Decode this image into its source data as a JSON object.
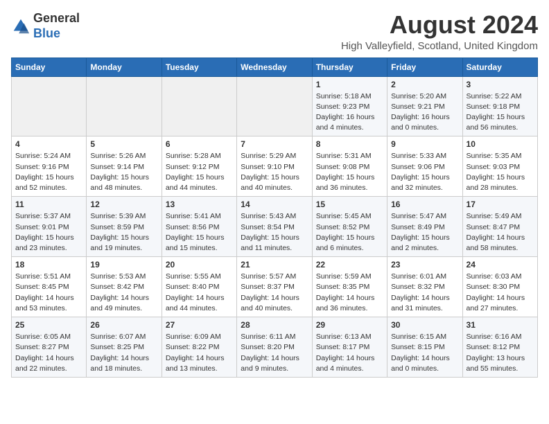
{
  "logo": {
    "general": "General",
    "blue": "Blue"
  },
  "header": {
    "month_title": "August 2024",
    "location": "High Valleyfield, Scotland, United Kingdom"
  },
  "weekdays": [
    "Sunday",
    "Monday",
    "Tuesday",
    "Wednesday",
    "Thursday",
    "Friday",
    "Saturday"
  ],
  "weeks": [
    [
      {
        "day": "",
        "info": ""
      },
      {
        "day": "",
        "info": ""
      },
      {
        "day": "",
        "info": ""
      },
      {
        "day": "",
        "info": ""
      },
      {
        "day": "1",
        "info": "Sunrise: 5:18 AM\nSunset: 9:23 PM\nDaylight: 16 hours\nand 4 minutes."
      },
      {
        "day": "2",
        "info": "Sunrise: 5:20 AM\nSunset: 9:21 PM\nDaylight: 16 hours\nand 0 minutes."
      },
      {
        "day": "3",
        "info": "Sunrise: 5:22 AM\nSunset: 9:18 PM\nDaylight: 15 hours\nand 56 minutes."
      }
    ],
    [
      {
        "day": "4",
        "info": "Sunrise: 5:24 AM\nSunset: 9:16 PM\nDaylight: 15 hours\nand 52 minutes."
      },
      {
        "day": "5",
        "info": "Sunrise: 5:26 AM\nSunset: 9:14 PM\nDaylight: 15 hours\nand 48 minutes."
      },
      {
        "day": "6",
        "info": "Sunrise: 5:28 AM\nSunset: 9:12 PM\nDaylight: 15 hours\nand 44 minutes."
      },
      {
        "day": "7",
        "info": "Sunrise: 5:29 AM\nSunset: 9:10 PM\nDaylight: 15 hours\nand 40 minutes."
      },
      {
        "day": "8",
        "info": "Sunrise: 5:31 AM\nSunset: 9:08 PM\nDaylight: 15 hours\nand 36 minutes."
      },
      {
        "day": "9",
        "info": "Sunrise: 5:33 AM\nSunset: 9:06 PM\nDaylight: 15 hours\nand 32 minutes."
      },
      {
        "day": "10",
        "info": "Sunrise: 5:35 AM\nSunset: 9:03 PM\nDaylight: 15 hours\nand 28 minutes."
      }
    ],
    [
      {
        "day": "11",
        "info": "Sunrise: 5:37 AM\nSunset: 9:01 PM\nDaylight: 15 hours\nand 23 minutes."
      },
      {
        "day": "12",
        "info": "Sunrise: 5:39 AM\nSunset: 8:59 PM\nDaylight: 15 hours\nand 19 minutes."
      },
      {
        "day": "13",
        "info": "Sunrise: 5:41 AM\nSunset: 8:56 PM\nDaylight: 15 hours\nand 15 minutes."
      },
      {
        "day": "14",
        "info": "Sunrise: 5:43 AM\nSunset: 8:54 PM\nDaylight: 15 hours\nand 11 minutes."
      },
      {
        "day": "15",
        "info": "Sunrise: 5:45 AM\nSunset: 8:52 PM\nDaylight: 15 hours\nand 6 minutes."
      },
      {
        "day": "16",
        "info": "Sunrise: 5:47 AM\nSunset: 8:49 PM\nDaylight: 15 hours\nand 2 minutes."
      },
      {
        "day": "17",
        "info": "Sunrise: 5:49 AM\nSunset: 8:47 PM\nDaylight: 14 hours\nand 58 minutes."
      }
    ],
    [
      {
        "day": "18",
        "info": "Sunrise: 5:51 AM\nSunset: 8:45 PM\nDaylight: 14 hours\nand 53 minutes."
      },
      {
        "day": "19",
        "info": "Sunrise: 5:53 AM\nSunset: 8:42 PM\nDaylight: 14 hours\nand 49 minutes."
      },
      {
        "day": "20",
        "info": "Sunrise: 5:55 AM\nSunset: 8:40 PM\nDaylight: 14 hours\nand 44 minutes."
      },
      {
        "day": "21",
        "info": "Sunrise: 5:57 AM\nSunset: 8:37 PM\nDaylight: 14 hours\nand 40 minutes."
      },
      {
        "day": "22",
        "info": "Sunrise: 5:59 AM\nSunset: 8:35 PM\nDaylight: 14 hours\nand 36 minutes."
      },
      {
        "day": "23",
        "info": "Sunrise: 6:01 AM\nSunset: 8:32 PM\nDaylight: 14 hours\nand 31 minutes."
      },
      {
        "day": "24",
        "info": "Sunrise: 6:03 AM\nSunset: 8:30 PM\nDaylight: 14 hours\nand 27 minutes."
      }
    ],
    [
      {
        "day": "25",
        "info": "Sunrise: 6:05 AM\nSunset: 8:27 PM\nDaylight: 14 hours\nand 22 minutes."
      },
      {
        "day": "26",
        "info": "Sunrise: 6:07 AM\nSunset: 8:25 PM\nDaylight: 14 hours\nand 18 minutes."
      },
      {
        "day": "27",
        "info": "Sunrise: 6:09 AM\nSunset: 8:22 PM\nDaylight: 14 hours\nand 13 minutes."
      },
      {
        "day": "28",
        "info": "Sunrise: 6:11 AM\nSunset: 8:20 PM\nDaylight: 14 hours\nand 9 minutes."
      },
      {
        "day": "29",
        "info": "Sunrise: 6:13 AM\nSunset: 8:17 PM\nDaylight: 14 hours\nand 4 minutes."
      },
      {
        "day": "30",
        "info": "Sunrise: 6:15 AM\nSunset: 8:15 PM\nDaylight: 14 hours\nand 0 minutes."
      },
      {
        "day": "31",
        "info": "Sunrise: 6:16 AM\nSunset: 8:12 PM\nDaylight: 13 hours\nand 55 minutes."
      }
    ]
  ]
}
